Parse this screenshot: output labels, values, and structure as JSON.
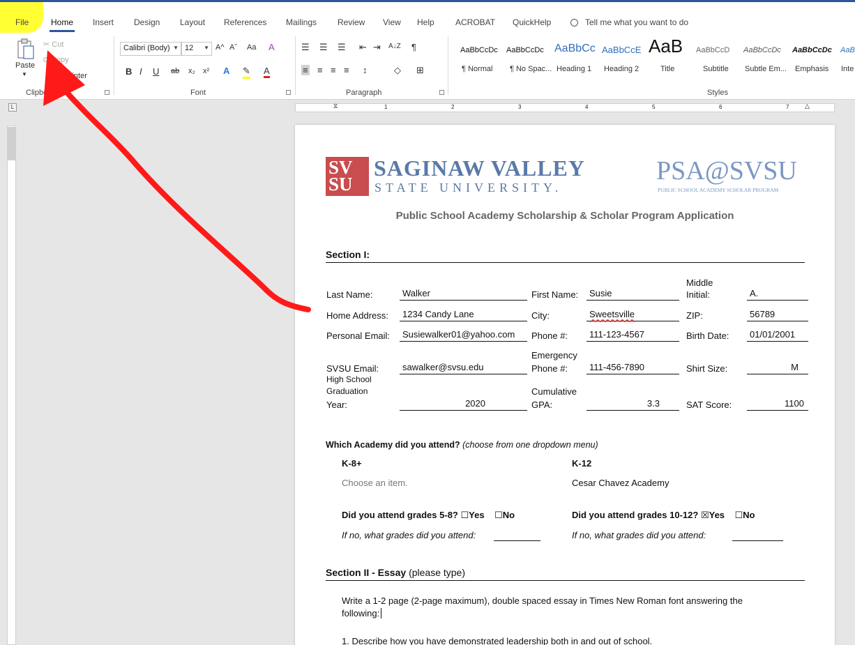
{
  "tabs": [
    "File",
    "Home",
    "Insert",
    "Design",
    "Layout",
    "References",
    "Mailings",
    "Review",
    "View",
    "Help",
    "ACROBAT",
    "QuickHelp"
  ],
  "tell_me": "Tell me what you want to do",
  "clipboard": {
    "paste": "Paste",
    "cut": "Cut",
    "copy": "Copy",
    "painter": "Painter",
    "group": "Clipboard"
  },
  "font": {
    "name": "Calibri (Body)",
    "size": "12",
    "group": "Font",
    "grow": "A^",
    "shrink": "Aˇ",
    "case": "Aa",
    "bold": "B",
    "italic": "I",
    "underline": "U",
    "strike": "ab",
    "sub": "x₂",
    "sup": "x²"
  },
  "paragraph": {
    "group": "Paragraph",
    "sort": "A↓Z",
    "pilcrow": "¶"
  },
  "styles": {
    "group": "Styles",
    "items": [
      {
        "sample": "AaBbCcDc",
        "name": "¶ Normal"
      },
      {
        "sample": "AaBbCcDc",
        "name": "¶ No Spac..."
      },
      {
        "sample": "AaBbCc",
        "name": "Heading 1"
      },
      {
        "sample": "AaBbCcE",
        "name": "Heading 2"
      },
      {
        "sample": "AaB",
        "name": "Title"
      },
      {
        "sample": "AaBbCcD",
        "name": "Subtitle"
      },
      {
        "sample": "AaBbCcDc",
        "name": "Subtle Em..."
      },
      {
        "sample": "AaBbCcDc",
        "name": "Emphasis"
      },
      {
        "sample": "AaBl",
        "name": "Inte"
      }
    ]
  },
  "ruler": {
    "numbers": [
      "1",
      "2",
      "3",
      "4",
      "5",
      "6",
      "7"
    ]
  },
  "doc": {
    "logo_sv": "SV",
    "logo_su": "SU",
    "logo_name1": "SAGINAW VALLEY",
    "logo_name2": "STATE UNIVERSITY.",
    "psa": "PSA@SVSU",
    "psa_sub": "PUBLIC SCHOOL ACADEMY SCHOLAR PROGRAM",
    "title": "Public School Academy Scholarship & Scholar Program Application",
    "section1": "Section I:",
    "fields": {
      "last_name_label": "Last Name:",
      "last_name": "Walker",
      "first_name_label": "First Name:",
      "first_name": "Susie",
      "mi_label1": "Middle",
      "mi_label2": "Initial:",
      "mi": "A.",
      "address_label": "Home Address:",
      "address": "1234 Candy Lane",
      "city_label": "City:",
      "city": "Sweetsville",
      "zip_label": "ZIP:",
      "zip": "56789",
      "pemail_label": "Personal Email:",
      "pemail": "Susiewalker01@yahoo.com",
      "phone_label": "Phone #:",
      "phone": "111-123-4567",
      "birth_label": "Birth Date:",
      "birth": "01/01/2001",
      "svsu_email_label": "SVSU Email:",
      "svsu_email": "sawalker@svsu.edu",
      "emerg_label1": "Emergency",
      "emerg_label2": "Phone #:",
      "emerg": "111-456-7890",
      "shirt_label": "Shirt Size:",
      "shirt": "M",
      "grad_label1": "High School",
      "grad_label2": "Graduation",
      "grad_label3": "Year:",
      "grad": "2020",
      "gpa_label1": "Cumulative",
      "gpa_label2": "GPA:",
      "gpa": "3.3",
      "sat_label": "SAT Score:",
      "sat": "1100"
    },
    "academy_q": "Which Academy did you attend?",
    "academy_hint": "(choose from one dropdown menu)",
    "k8_label": "K-8+",
    "k8_value": "Choose an item.",
    "k12_label": "K-12",
    "k12_value": "Cesar Chavez Academy",
    "q58": "Did you attend grades 5-8?",
    "q1012": "Did you attend grades 10-12?",
    "yes": "Yes",
    "no": "No",
    "if_no": "If no, what grades did you attend:",
    "section2_bold": "Section II - Essay",
    "section2_rest": "(please type)",
    "essay_line1": "Write a 1-2 page (2-page maximum), double spaced essay in Times New Roman font answering the",
    "essay_line2": "following:",
    "item1": "1.   Describe how you have demonstrated leadership both in and out of school."
  }
}
